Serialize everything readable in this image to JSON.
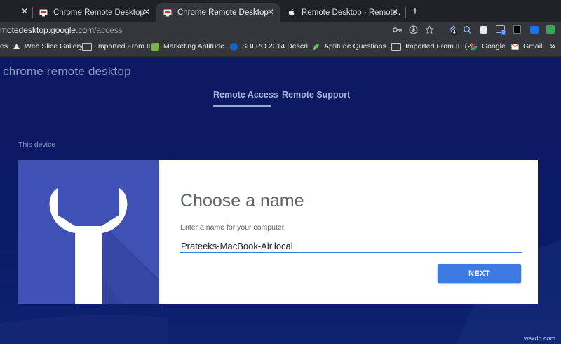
{
  "browser": {
    "tabs": [
      {
        "title": "Chrome Remote Desktop - Chro",
        "active": false,
        "close": "✕"
      },
      {
        "title": "Chrome Remote Desktop",
        "active": true,
        "close": "✕"
      },
      {
        "title": "Remote Desktop - Remote Assis",
        "active": false,
        "close": "✕"
      }
    ],
    "first_tab_close": "✕",
    "new_tab": "+",
    "url_host": "motedesktop.google.com",
    "url_path": "/access",
    "extension_badges": {
      "first": "4",
      "second": "0"
    },
    "bookmarks": [
      {
        "label": "es"
      },
      {
        "label": "Web Slice Gallery"
      },
      {
        "label": "Imported From IE"
      },
      {
        "label": "Marketing Aptitude..."
      },
      {
        "label": "SBI PO 2014 Descri..."
      },
      {
        "label": "Aptitude Questions..."
      },
      {
        "label": "Imported From IE (2)"
      },
      {
        "label": "Google"
      },
      {
        "label": "Gmail"
      }
    ]
  },
  "app": {
    "brand": "chrome remote desktop",
    "nav": {
      "remote_access": "Remote Access",
      "remote_support": "Remote Support"
    },
    "section_label": "This device",
    "dialog": {
      "title": "Choose a name",
      "instruction": "Enter a name for your computer.",
      "name_value": "Prateeks-MacBook-Air.local",
      "next_label": "NEXT"
    }
  },
  "watermark": "wsxdn.com",
  "colors": {
    "accent": "#3d7be3",
    "panel_left": "#3f51b5",
    "page_bg": "#0c1a63"
  }
}
